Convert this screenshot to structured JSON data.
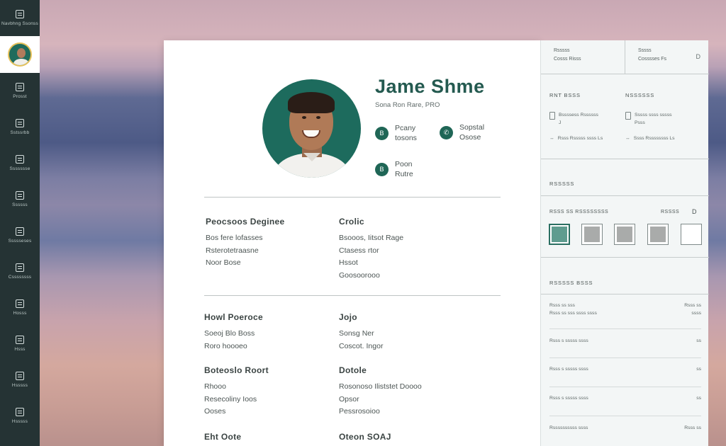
{
  "rail": {
    "items": [
      {
        "icon": "briefcase-icon",
        "label": "Navbhng Ssonss"
      },
      {
        "icon": "avatar",
        "label": ""
      },
      {
        "icon": "list-icon",
        "label": "Prosst"
      },
      {
        "icon": "document-icon",
        "label": "Sstssrbb"
      },
      {
        "icon": "folder-icon",
        "label": "Ssssssse"
      },
      {
        "icon": "image-icon",
        "label": "Ssssss"
      },
      {
        "icon": "grid-icon",
        "label": "Ssssseses"
      },
      {
        "icon": "chart-icon",
        "label": "Cssssssss"
      },
      {
        "icon": "phone-icon",
        "label": "Hosss"
      },
      {
        "icon": "people-icon",
        "label": "Hsss"
      },
      {
        "icon": "settings-icon",
        "label": "Hsssss"
      },
      {
        "icon": "lock-icon",
        "label": "Hsssss"
      }
    ]
  },
  "profile": {
    "name": "Jame Shme",
    "subtitle": "Sona Ron Rare,  PRO",
    "contacts": [
      {
        "glyph": "B",
        "line1": "Pcany",
        "line2": "tosons"
      },
      {
        "glyph": "✆",
        "line1": "Sopstal",
        "line2": "Osose"
      },
      {
        "glyph": "B",
        "line1": "Poon",
        "line2": "Rutre"
      }
    ]
  },
  "sections": [
    {
      "title": "Peocsoos Deginee",
      "lines": [
        "Bos fere lofasses",
        "Rsterotetraasne",
        "Noor Bose"
      ]
    },
    {
      "title": "Crolic",
      "lines": [
        "Bsooos,  Iitsot Rage",
        "Ctasess rtor",
        "Hssot",
        "Goosoorooo"
      ]
    },
    {
      "title": "Howl Poeroce",
      "lines": [
        "Soeoj Blo Boss",
        "Roro hoooeo"
      ]
    },
    {
      "title": "Jojo",
      "lines": [
        "Sonsg Ner",
        "Coscot.  Ingor"
      ]
    },
    {
      "title": "Boteoslo Roort",
      "lines": [
        "Rhooo",
        "Resecoliny  Ioos",
        "Ooses"
      ]
    },
    {
      "title": "Dotole",
      "lines": [
        "Rosonoso  Iliststet  Doooo",
        "Opsor",
        "Pessrosoioo"
      ]
    },
    {
      "title": "Eht Oote",
      "lines": []
    },
    {
      "title": "Oteon  SOAJ",
      "lines": []
    }
  ],
  "panel": {
    "tabs": [
      {
        "line1": "Rsssss",
        "line2": "Cosss Risss"
      },
      {
        "line1": "Sssss",
        "line2": "Cosssses Fs"
      }
    ],
    "section1_labels": [
      "RNT BSSS",
      "NSSSSSS"
    ],
    "checks": [
      {
        "line1": "Bssssess Rssssss",
        "line2": "J"
      },
      {
        "line1": "Sssss ssss  sssss",
        "line2": "Psss"
      }
    ],
    "check_rows": [
      "Rsss  Rsssss ssss Ls",
      "Ssss Rssssssss Ls"
    ],
    "section2_title": "RSSSSS",
    "swatch_label": "RSSS SS RSSSSSSSS",
    "swatch_label_right": "RSSSS",
    "swatches": [
      {
        "color": "#5f9c8f",
        "selected": true
      },
      {
        "color": "#a9abaa",
        "selected": false
      },
      {
        "color": "#a9abaa",
        "selected": false
      },
      {
        "color": "#a9abaa",
        "selected": false
      },
      {
        "color": "#ffffff",
        "selected": false
      }
    ],
    "section3_title": "RSSSSS BSSS",
    "rows": [
      {
        "left": "Rsss ss sss",
        "left2": "Rsss ss sss ssss ssss",
        "right": "Rsss ss",
        "right2": "ssss"
      },
      {
        "left": "Rsss s sssss ssss",
        "right": "ss"
      },
      {
        "left": "Rsss s sssss ssss",
        "right": "ss"
      },
      {
        "left": "Rsss s sssss ssss",
        "right": "ss"
      },
      {
        "left": "Rsss s sssss ssss",
        "right": "ss"
      },
      {
        "left": "Rssssssssss ssss",
        "right": "Rsss ss"
      }
    ]
  }
}
